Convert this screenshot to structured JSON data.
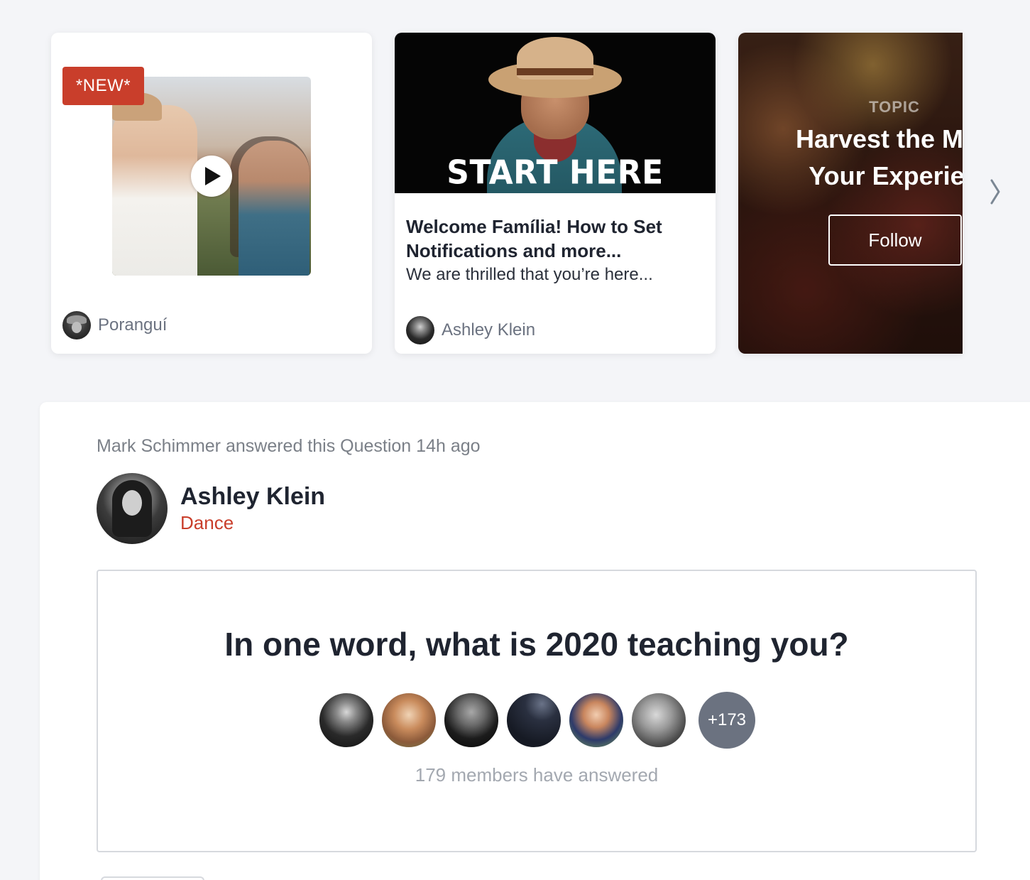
{
  "carousel": {
    "cards": [
      {
        "badge": "*NEW*",
        "author": "Poranguí"
      },
      {
        "image_caption": "START HERE",
        "title": "Welcome Família! How to Set Notifications and more...",
        "subtitle": "We are thrilled that you’re here...",
        "author": "Ashley Klein"
      },
      {
        "label": "TOPIC",
        "title_line1": "Harvest the Med",
        "title_line2": "Your Experien",
        "follow_label": "Follow"
      }
    ],
    "next_glyph": "❯"
  },
  "feed": {
    "activity": "Mark Schimmer answered this Question 14h ago",
    "poster": {
      "name": "Ashley Klein",
      "topic": "Dance"
    },
    "question": {
      "text": "In one word, what is 2020 teaching you?",
      "more_count": "+173",
      "answered_text": "179 members have answered"
    }
  },
  "colors": {
    "accent": "#c93e2b",
    "muted_text": "#7b8088",
    "background": "#f4f5f8"
  }
}
